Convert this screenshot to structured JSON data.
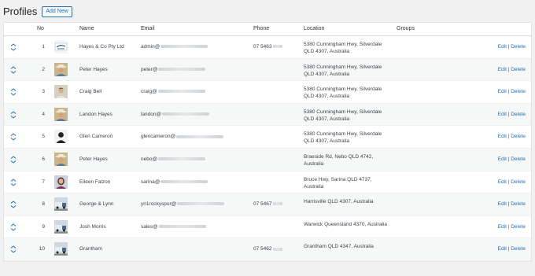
{
  "header": {
    "title": "Profiles",
    "add_new": "Add New"
  },
  "columns": {
    "no": "No",
    "name": "Name",
    "email": "Email",
    "phone": "Phone",
    "location": "Location",
    "groups": "Groups"
  },
  "actions": {
    "edit": "Edit",
    "sep": "|",
    "delete": "Delete"
  },
  "rows": [
    {
      "no": "1",
      "name": "Hayes & Co Pty Ltd",
      "email": "admin@",
      "phone": "07 5463",
      "loc1": "5380 Cunningham Hwy, Silverdale",
      "loc2": "QLD 4307, Australia",
      "avatar": "logo"
    },
    {
      "no": "2",
      "name": "Peter Hayes",
      "email": "peter@",
      "phone": "",
      "loc1": "5380 Cunningham Hwy, Silverdale",
      "loc2": "QLD 4307, Australia",
      "avatar": "cowboy"
    },
    {
      "no": "3",
      "name": "Craig Bell",
      "email": "craig@",
      "phone": "",
      "loc1": "5380 Cunningham Hwy, Silverdale",
      "loc2": "QLD 4307, Australia",
      "avatar": "person"
    },
    {
      "no": "4",
      "name": "Landon Hayes",
      "email": "landon@",
      "phone": "",
      "loc1": "5380 Cunningham Hwy, Silverdale",
      "loc2": "QLD 4307, Australia",
      "avatar": "cowboy"
    },
    {
      "no": "5",
      "name": "Glen Cameron",
      "email": "glencameron@",
      "phone": "",
      "loc1": "5380 Cunningham Hwy, Silverdale",
      "loc2": "QLD 4307, Australia",
      "avatar": "silhouette"
    },
    {
      "no": "6",
      "name": "Peter Hayes",
      "email": "nebo@",
      "phone": "",
      "loc1": "Braeside Rd, Nebo QLD 4742,",
      "loc2": "Australia",
      "avatar": "cowboy"
    },
    {
      "no": "7",
      "name": "Eileen Falzon",
      "email": "sarina@",
      "phone": "",
      "loc1": "Bruce Hwy, Sarina QLD 4737,",
      "loc2": "Australia",
      "avatar": "woman"
    },
    {
      "no": "8",
      "name": "George & Lynn",
      "email": "yn1rockyspur@",
      "phone": "07 5467",
      "loc1": "Harrisville QLD 4307, Australia",
      "loc2": "",
      "avatar": "truck"
    },
    {
      "no": "9",
      "name": "Josh Morris",
      "email": "sales@",
      "phone": "",
      "loc1": "Warwick Queensland 4370, Australia",
      "loc2": "",
      "avatar": "truck"
    },
    {
      "no": "10",
      "name": "Grantham",
      "email": "",
      "phone": "07 5462",
      "loc1": "Grantham QLD 4347, Australia",
      "loc2": "",
      "avatar": "truck"
    }
  ],
  "colors": {
    "accent": "#2271b1",
    "row_alt": "#f6f7f7",
    "text": "#3c434a"
  }
}
